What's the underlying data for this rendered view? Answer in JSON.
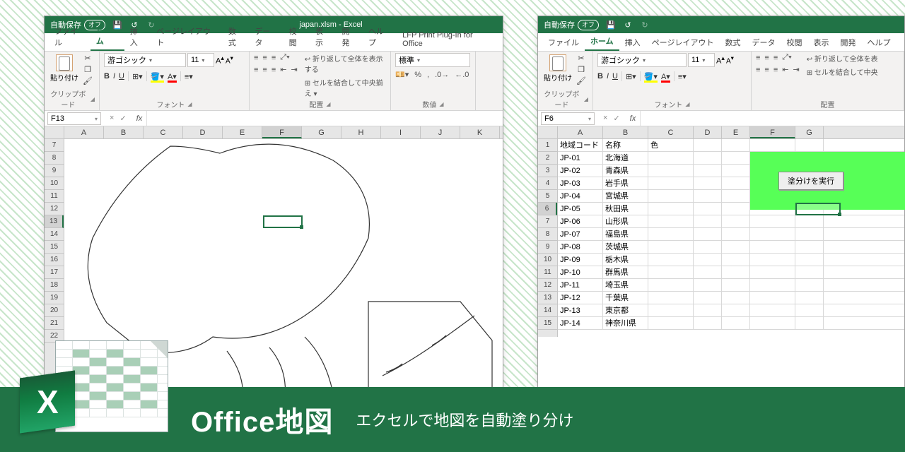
{
  "banner": {
    "title": "Office地図",
    "subtitle": "エクセルで地図を自動塗り分け",
    "logo_letter": "X"
  },
  "leftWin": {
    "titlebar": {
      "auto_save": "自動保存",
      "auto_save_state": "オフ",
      "doc_title": "japan.xlsm - Excel"
    },
    "tabs": [
      "ファイル",
      "ホーム",
      "挿入",
      "ページレイアウト",
      "数式",
      "データ",
      "校閲",
      "表示",
      "開発",
      "ヘルプ",
      "LFP Print Plug-In for Office"
    ],
    "active_tab": 1,
    "ribbon": {
      "clipboard": {
        "paste": "貼り付け",
        "label": "クリップボード"
      },
      "font": {
        "name": "游ゴシック",
        "size": "11",
        "label": "フォント",
        "btns": [
          "B",
          "I",
          "U"
        ]
      },
      "align": {
        "wrap": "折り返して全体を表示する",
        "merge": "セルを結合して中央揃え",
        "label": "配置"
      },
      "number": {
        "format": "標準",
        "label": "数値"
      }
    },
    "namebox": "F13",
    "cols": [
      "A",
      "B",
      "C",
      "D",
      "E",
      "F",
      "G",
      "H",
      "I",
      "J",
      "K"
    ],
    "row_start": 7,
    "row_end": 17,
    "sel_row": 13,
    "sel_col": "F"
  },
  "rightWin": {
    "titlebar": {
      "auto_save": "自動保存",
      "auto_save_state": "オフ"
    },
    "tabs": [
      "ファイル",
      "ホーム",
      "挿入",
      "ページレイアウト",
      "数式",
      "データ",
      "校閲",
      "表示",
      "開発",
      "ヘルプ"
    ],
    "active_tab": 1,
    "ribbon": {
      "clipboard": {
        "paste": "貼り付け",
        "label": "クリップボード"
      },
      "font": {
        "name": "游ゴシック",
        "size": "11",
        "label": "フォント",
        "btns": [
          "B",
          "I",
          "U"
        ]
      },
      "align": {
        "wrap": "折り返して全体を表",
        "merge": "セルを結合して中央",
        "label": "配置"
      }
    },
    "namebox": "F6",
    "cols": [
      "A",
      "B",
      "C",
      "D",
      "E",
      "F",
      "G"
    ],
    "headers": {
      "a": "地域コード",
      "b": "名称",
      "c": "色"
    },
    "data": [
      {
        "code": "JP-01",
        "name": "北海道"
      },
      {
        "code": "JP-02",
        "name": "青森県"
      },
      {
        "code": "JP-03",
        "name": "岩手県"
      },
      {
        "code": "JP-04",
        "name": "宮城県"
      },
      {
        "code": "JP-05",
        "name": "秋田県"
      },
      {
        "code": "JP-06",
        "name": "山形県"
      },
      {
        "code": "JP-07",
        "name": "福島県"
      },
      {
        "code": "JP-08",
        "name": "茨城県"
      },
      {
        "code": "JP-09",
        "name": "栃木県"
      },
      {
        "code": "JP-10",
        "name": "群馬県"
      },
      {
        "code": "JP-11",
        "name": "埼玉県"
      },
      {
        "code": "JP-12",
        "name": "千葉県"
      },
      {
        "code": "JP-13",
        "name": "東京都"
      },
      {
        "code": "JP-14",
        "name": "神奈川県"
      }
    ],
    "sel_row": 6,
    "exec_button": "塗分けを実行"
  }
}
